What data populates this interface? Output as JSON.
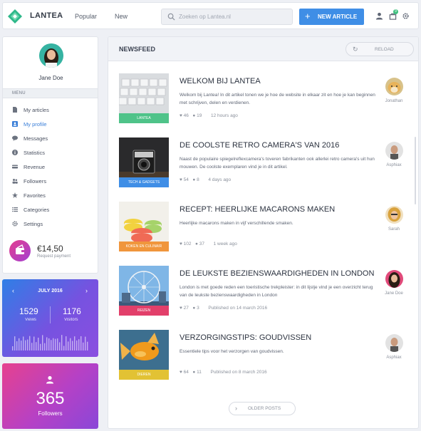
{
  "app": {
    "brand": "LANTEA",
    "nav": [
      "Popular",
      "New"
    ],
    "search_placeholder": "Zoeken op Lantea.nl",
    "new_article": "NEW ARTICLE",
    "notification_count": "9"
  },
  "profile": {
    "name": "Jane Doe",
    "menu_header": "MENU",
    "menu": [
      {
        "label": "My articles",
        "icon": "document-icon"
      },
      {
        "label": "My profile",
        "icon": "profile-card-icon",
        "active": true
      },
      {
        "label": "Messages",
        "icon": "chat-bubble-icon"
      },
      {
        "label": "Statistics",
        "icon": "info-icon"
      },
      {
        "label": "Revenue",
        "icon": "credit-card-icon"
      },
      {
        "label": "Followers",
        "icon": "users-icon"
      },
      {
        "label": "Favorites",
        "icon": "star-icon"
      },
      {
        "label": "Categories",
        "icon": "list-icon"
      },
      {
        "label": "Settings",
        "icon": "gear-icon"
      }
    ],
    "payment": {
      "amount": "€14,50",
      "label": "Request payment"
    }
  },
  "stats": {
    "month": "JULY 2016",
    "views": "1529",
    "views_label": "Views",
    "visitors": "1176",
    "visitors_label": "Visitors"
  },
  "followers": {
    "count": "365",
    "label": "Followers"
  },
  "feed": {
    "title": "NEWSFEED",
    "reload": "RELOAD",
    "older": "OLDER POSTS",
    "posts": [
      {
        "title": "WELKOM BIJ LANTEA",
        "desc": "Welkom bij Lantea! In dit artikel tonen we je hoe de website in elkaar zit en hoe je kan beginnen met schrijven, delen en verdienen.",
        "category": "LANTEA",
        "cat_color": "#4fc389",
        "likes": "46",
        "comments": "19",
        "time": "12 hours ago",
        "author": "Jonathan"
      },
      {
        "title": "DE COOLSTE RETRO CAMERA'S VAN 2016",
        "desc": "Naast de populaire spiegelreflexcamera's toveren fabrikanten ook allerlei retro camera's uit hun mouwen. De coolste exemplaren vind je in dit artikel.",
        "category": "TECH & GADGETS",
        "cat_color": "#3f8ee6",
        "likes": "54",
        "comments": "8",
        "time": "4 days ago",
        "author": "Asphiax"
      },
      {
        "title": "RECEPT: HEERLIJKE MACARONS MAKEN",
        "desc": "Heerlijke macarons maken in vijf verschillende smaken.",
        "category": "KOKEN EN CULINAIR",
        "cat_color": "#f0963c",
        "likes": "102",
        "comments": "37",
        "time": "1 week ago",
        "author": "Sarah"
      },
      {
        "title": "DE LEUKSTE BEZIENSWAARDIGHEDEN IN LONDON",
        "desc": "London is met goede reden een toeristische trekpleister: in dit lijstje vind je een overzicht terug van de leukste bezienswaardigheden in London",
        "category": "REIZEN",
        "cat_color": "#e23f6a",
        "likes": "27",
        "comments": "3",
        "time": "Published on 14 march 2016",
        "author": "Jane Doe"
      },
      {
        "title": "VERZORGINGSTIPS: GOUDVISSEN",
        "desc": "Essentiele tips voor het verzorgen van goudvissen.",
        "category": "DIEREN",
        "cat_color": "#e2c234",
        "likes": "64",
        "comments": "11",
        "time": "Published on 8 march 2016",
        "author": "Asphiax"
      }
    ]
  }
}
